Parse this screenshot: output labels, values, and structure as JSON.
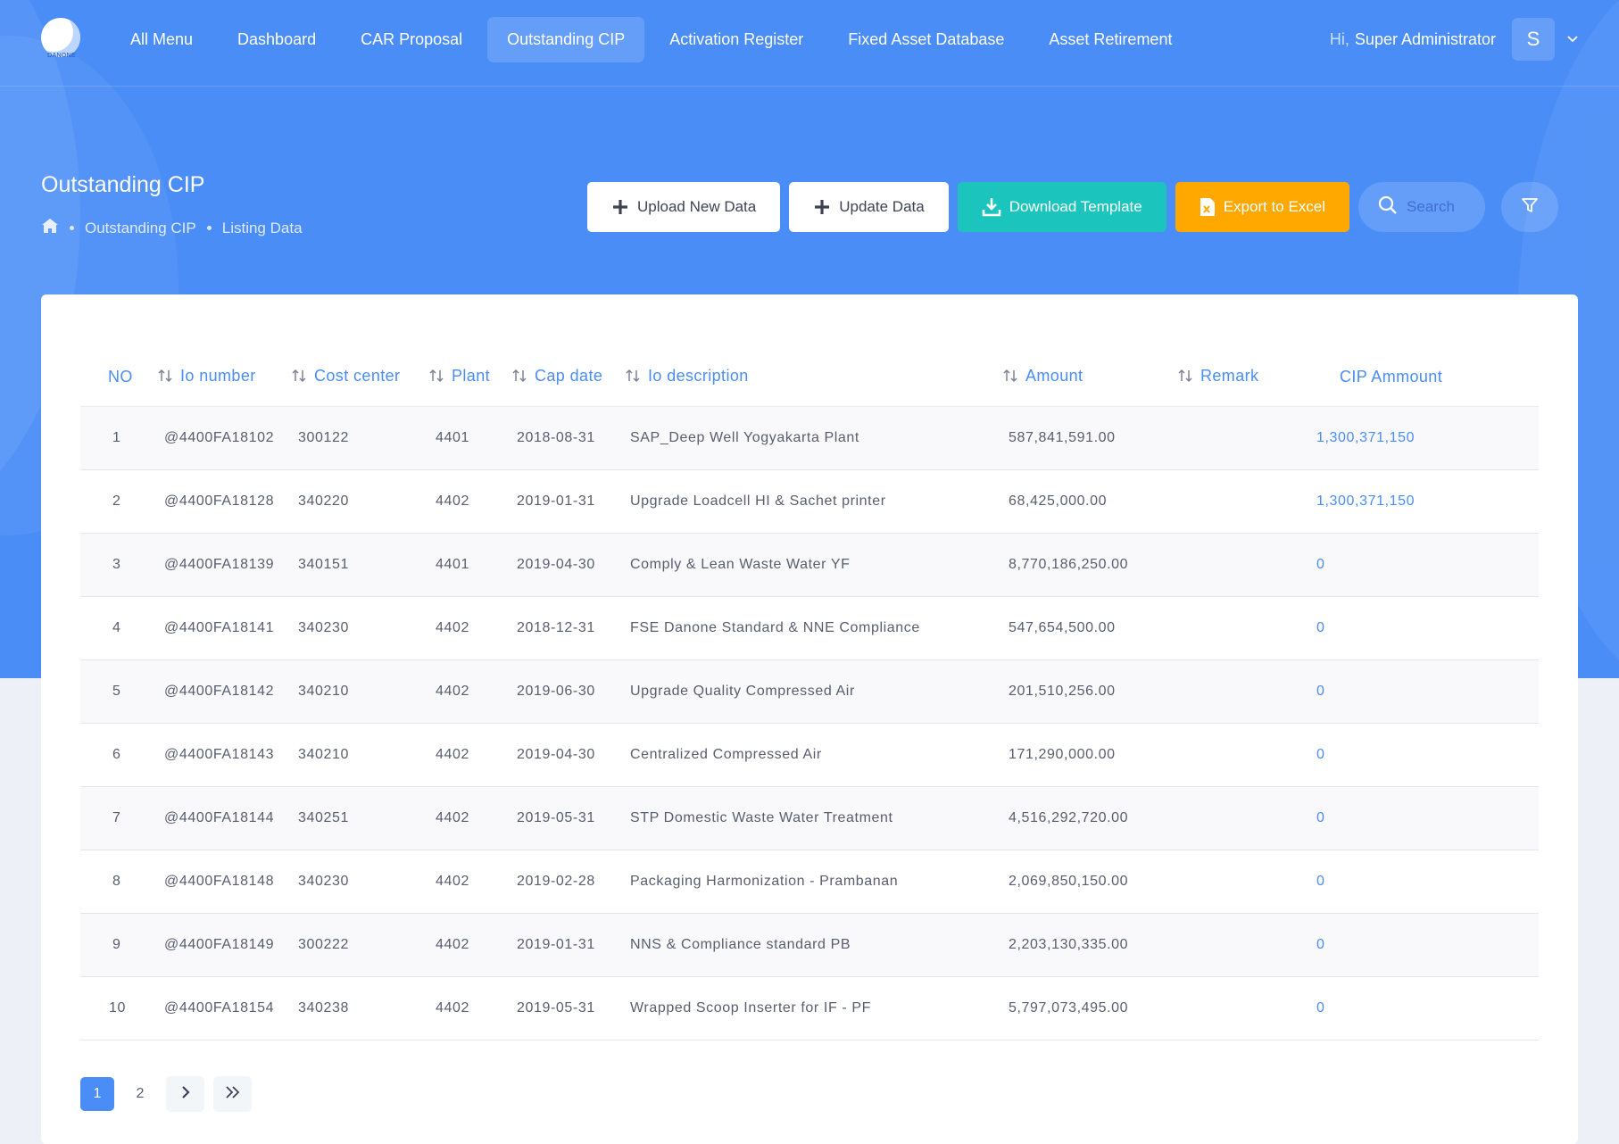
{
  "brand": {
    "logo_text": "DANONE"
  },
  "nav": {
    "items": [
      {
        "label": "All Menu",
        "active": false
      },
      {
        "label": "Dashboard",
        "active": false
      },
      {
        "label": "CAR Proposal",
        "active": false
      },
      {
        "label": "Outstanding CIP",
        "active": true
      },
      {
        "label": "Activation Register",
        "active": false
      },
      {
        "label": "Fixed Asset Database",
        "active": false
      },
      {
        "label": "Asset Retirement",
        "active": false
      }
    ]
  },
  "user": {
    "greeting": "Hi,",
    "name": "Super Administrator",
    "initial": "S"
  },
  "page": {
    "title": "Outstanding CIP",
    "breadcrumb": [
      "Outstanding CIP",
      "Listing Data"
    ]
  },
  "actions": {
    "upload_label": "Upload New Data",
    "update_label": "Update Data",
    "download_label": "Download Template",
    "export_label": "Export to Excel",
    "search_placeholder": "Search"
  },
  "colors": {
    "primary": "#4a8df7",
    "teal": "#1bc5bd",
    "orange": "#ffa800",
    "text": "#595d6e"
  },
  "table": {
    "columns": [
      {
        "label": "NO",
        "sortable": false
      },
      {
        "label": "Io number",
        "sortable": true
      },
      {
        "label": "Cost center",
        "sortable": true
      },
      {
        "label": "Plant",
        "sortable": true
      },
      {
        "label": "Cap date",
        "sortable": true
      },
      {
        "label": "Io description",
        "sortable": true
      },
      {
        "label": "Amount",
        "sortable": true
      },
      {
        "label": "Remark",
        "sortable": true
      },
      {
        "label": "CIP Ammount",
        "sortable": false
      }
    ],
    "rows": [
      {
        "no": "1",
        "io": "@4400FA18102",
        "cc": "300122",
        "plant": "4401",
        "cap": "2018-08-31",
        "desc": "SAP_Deep Well Yogyakarta Plant",
        "amount": "587,841,591.00",
        "remark": "",
        "cip": "1,300,371,150"
      },
      {
        "no": "2",
        "io": "@4400FA18128",
        "cc": "340220",
        "plant": "4402",
        "cap": "2019-01-31",
        "desc": "Upgrade Loadcell HI & Sachet printer",
        "amount": "68,425,000.00",
        "remark": "",
        "cip": "1,300,371,150"
      },
      {
        "no": "3",
        "io": "@4400FA18139",
        "cc": "340151",
        "plant": "4401",
        "cap": "2019-04-30",
        "desc": "Comply & Lean Waste Water YF",
        "amount": "8,770,186,250.00",
        "remark": "",
        "cip": "0"
      },
      {
        "no": "4",
        "io": "@4400FA18141",
        "cc": "340230",
        "plant": "4402",
        "cap": "2018-12-31",
        "desc": "FSE Danone Standard & NNE Compliance",
        "amount": "547,654,500.00",
        "remark": "",
        "cip": "0"
      },
      {
        "no": "5",
        "io": "@4400FA18142",
        "cc": "340210",
        "plant": "4402",
        "cap": "2019-06-30",
        "desc": "Upgrade Quality Compressed Air",
        "amount": "201,510,256.00",
        "remark": "",
        "cip": "0"
      },
      {
        "no": "6",
        "io": "@4400FA18143",
        "cc": "340210",
        "plant": "4402",
        "cap": "2019-04-30",
        "desc": "Centralized Compressed Air",
        "amount": "171,290,000.00",
        "remark": "",
        "cip": "0"
      },
      {
        "no": "7",
        "io": "@4400FA18144",
        "cc": "340251",
        "plant": "4402",
        "cap": "2019-05-31",
        "desc": "STP Domestic Waste Water Treatment",
        "amount": "4,516,292,720.00",
        "remark": "",
        "cip": "0"
      },
      {
        "no": "8",
        "io": "@4400FA18148",
        "cc": "340230",
        "plant": "4402",
        "cap": "2019-02-28",
        "desc": "Packaging Harmonization - Prambanan",
        "amount": "2,069,850,150.00",
        "remark": "",
        "cip": "0"
      },
      {
        "no": "9",
        "io": "@4400FA18149",
        "cc": "300222",
        "plant": "4402",
        "cap": "2019-01-31",
        "desc": "NNS & Compliance standard PB",
        "amount": "2,203,130,335.00",
        "remark": "",
        "cip": "0"
      },
      {
        "no": "10",
        "io": "@4400FA18154",
        "cc": "340238",
        "plant": "4402",
        "cap": "2019-05-31",
        "desc": "Wrapped Scoop Inserter for IF - PF",
        "amount": "5,797,073,495.00",
        "remark": "",
        "cip": "0"
      }
    ]
  },
  "pagination": {
    "pages": [
      "1",
      "2"
    ],
    "current": "1"
  }
}
